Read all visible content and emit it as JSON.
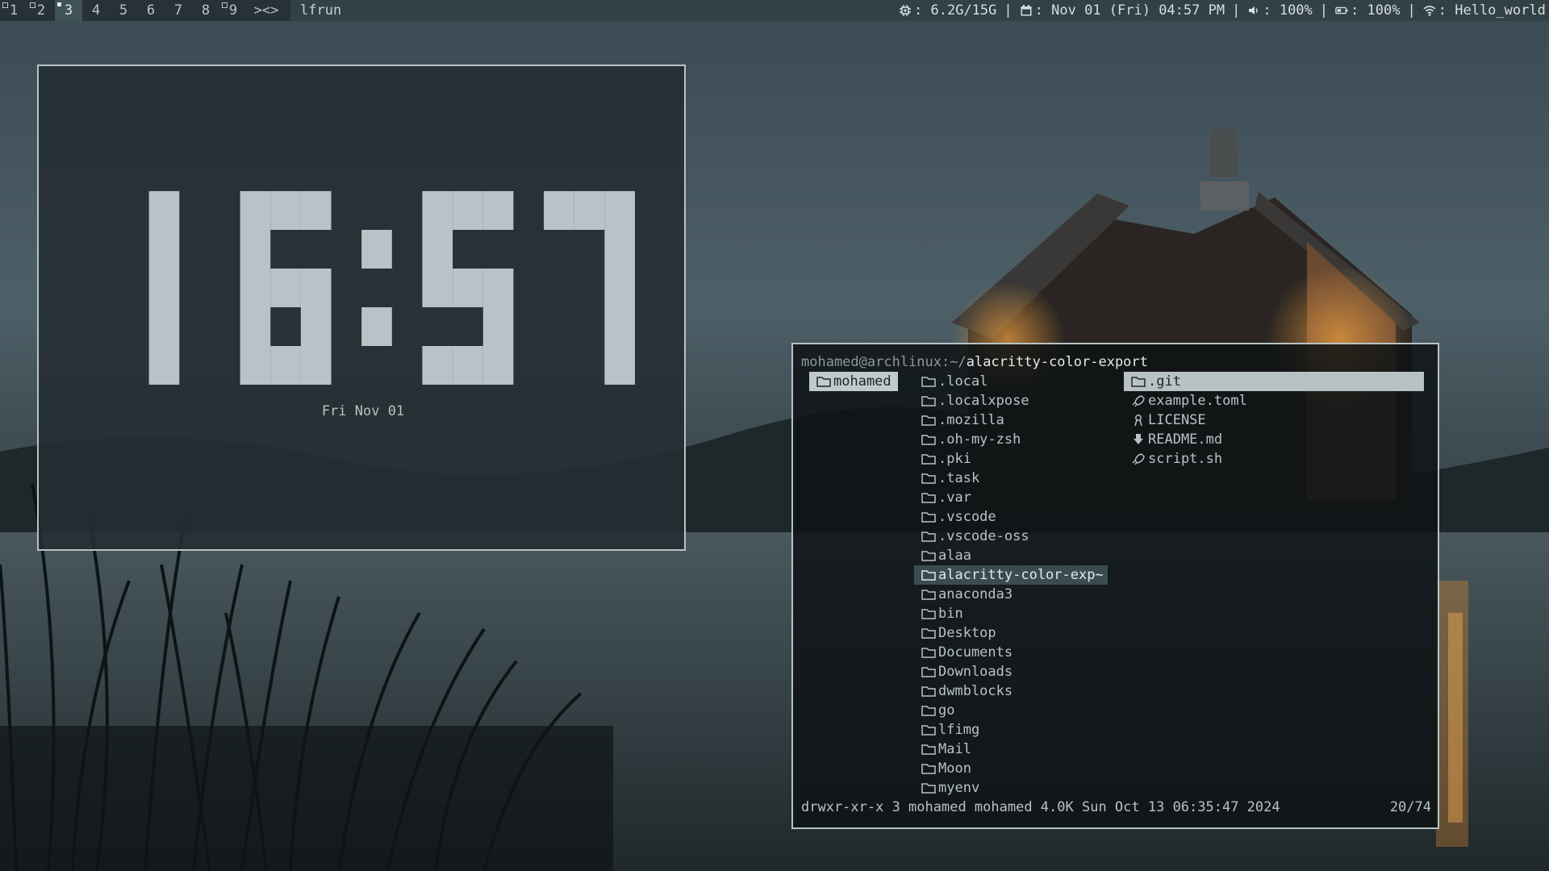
{
  "topbar": {
    "tags": [
      {
        "label": "1",
        "state": "occupied"
      },
      {
        "label": "2",
        "state": "occupied"
      },
      {
        "label": "3",
        "state": "active"
      },
      {
        "label": "4",
        "state": "empty"
      },
      {
        "label": "5",
        "state": "empty"
      },
      {
        "label": "6",
        "state": "empty"
      },
      {
        "label": "7",
        "state": "empty"
      },
      {
        "label": "8",
        "state": "empty"
      },
      {
        "label": "9",
        "state": "occupied"
      }
    ],
    "layout_symbol": "><>",
    "window_title": "lfrun",
    "status": {
      "memory": {
        "icon": "cpu-icon",
        "value": "6.2G/15G"
      },
      "date": {
        "icon": "calendar-icon",
        "value": "Nov 01 (Fri) 04:57 PM"
      },
      "volume": {
        "icon": "speaker-icon",
        "value": "100%"
      },
      "battery": {
        "icon": "battery-icon",
        "value": "100%"
      },
      "wifi": {
        "icon": "wifi-icon",
        "value": "Hello_world"
      },
      "separator": "|",
      "colon": ":"
    }
  },
  "clock": {
    "time": "16:57",
    "date": "Fri Nov 01"
  },
  "lf": {
    "path_user": "mohamed@archlinux",
    "path_sep": ":~/",
    "path_dir": "alacritty-color-export",
    "parent_column": [
      {
        "name": "mohamed",
        "icon": "folder-icon",
        "selected": true
      }
    ],
    "current_column": [
      {
        "name": ".local",
        "icon": "folder-icon"
      },
      {
        "name": ".localxpose",
        "icon": "folder-icon"
      },
      {
        "name": ".mozilla",
        "icon": "folder-icon"
      },
      {
        "name": ".oh-my-zsh",
        "icon": "folder-icon"
      },
      {
        "name": ".pki",
        "icon": "folder-icon"
      },
      {
        "name": ".task",
        "icon": "folder-icon"
      },
      {
        "name": ".var",
        "icon": "folder-icon"
      },
      {
        "name": ".vscode",
        "icon": "folder-icon"
      },
      {
        "name": ".vscode-oss",
        "icon": "folder-icon"
      },
      {
        "name": "alaa",
        "icon": "folder-icon"
      },
      {
        "name": "alacritty-color-exp~",
        "icon": "folder-icon",
        "selected": true
      },
      {
        "name": "anaconda3",
        "icon": "folder-icon"
      },
      {
        "name": "bin",
        "icon": "folder-icon"
      },
      {
        "name": "Desktop",
        "icon": "folder-icon"
      },
      {
        "name": "Documents",
        "icon": "folder-icon"
      },
      {
        "name": "Downloads",
        "icon": "folder-icon"
      },
      {
        "name": "dwmblocks",
        "icon": "folder-icon"
      },
      {
        "name": "go",
        "icon": "folder-icon"
      },
      {
        "name": "lfimg",
        "icon": "folder-icon"
      },
      {
        "name": "Mail",
        "icon": "folder-icon"
      },
      {
        "name": "Moon",
        "icon": "folder-icon"
      },
      {
        "name": "myenv",
        "icon": "folder-icon"
      }
    ],
    "preview_column": [
      {
        "name": ".git",
        "icon": "folder-icon",
        "selected": true
      },
      {
        "name": "example.toml",
        "icon": "rocket-icon"
      },
      {
        "name": "LICENSE",
        "icon": "license-icon"
      },
      {
        "name": "README.md",
        "icon": "download-icon"
      },
      {
        "name": "script.sh",
        "icon": "rocket-icon"
      }
    ],
    "status_line": "drwxr-xr-x 3 mohamed mohamed 4.0K Sun Oct 13 06:35:47 2024",
    "count": "20/74"
  }
}
